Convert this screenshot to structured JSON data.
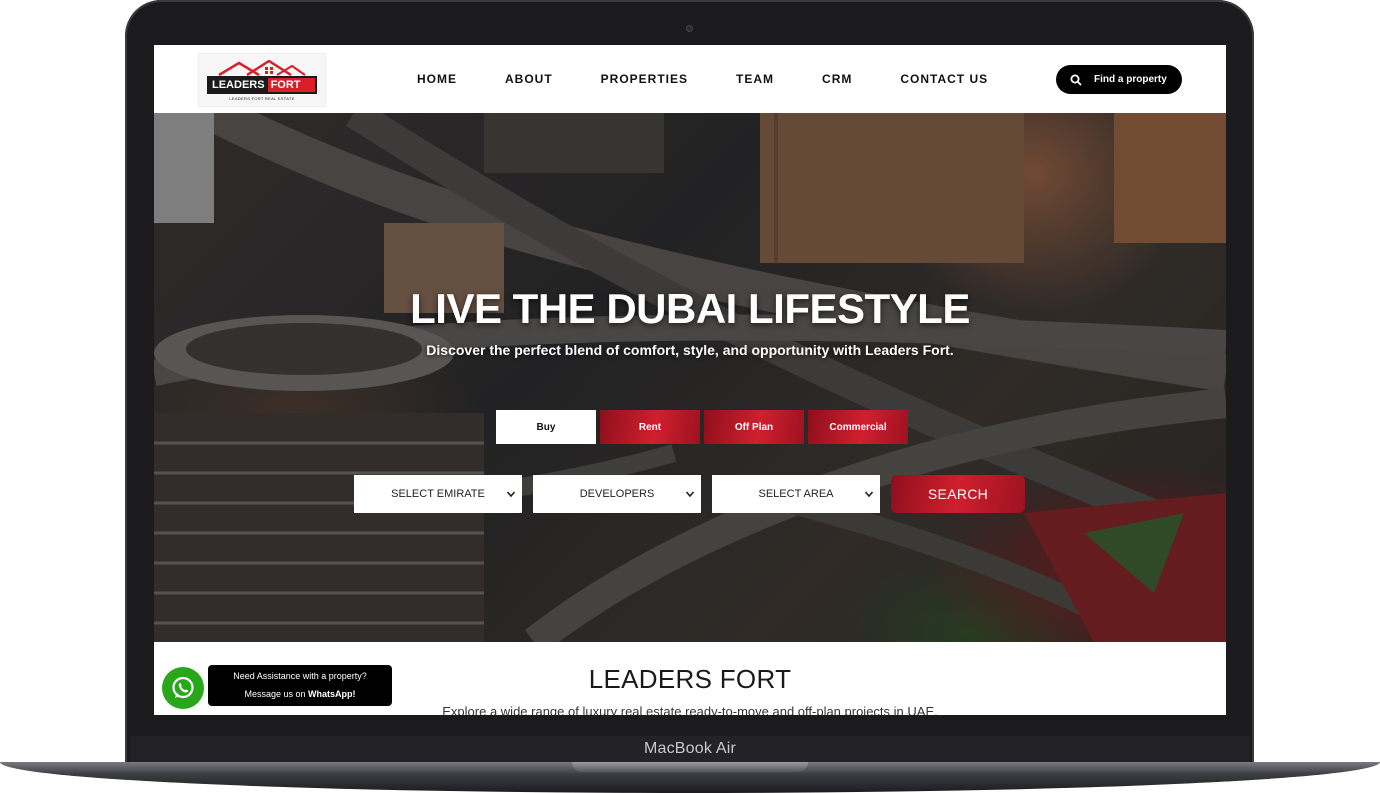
{
  "device": {
    "label": "MacBook Air"
  },
  "header": {
    "logo": {
      "word1": "LEADERS",
      "word2": "FORT",
      "tagline": "LEADERS FORT REAL ESTATE"
    },
    "nav": [
      "HOME",
      "ABOUT",
      "PROPERTIES",
      "TEAM",
      "CRM",
      "CONTACT US"
    ],
    "find_button": "Find a property"
  },
  "hero": {
    "title": "LIVE THE DUBAI LIFESTYLE",
    "subtitle": "Discover the perfect blend of comfort, style, and opportunity with Leaders Fort.",
    "tabs": [
      {
        "label": "Buy",
        "active": true
      },
      {
        "label": "Rent",
        "active": false
      },
      {
        "label": "Off Plan",
        "active": false
      },
      {
        "label": "Commercial",
        "active": false
      }
    ],
    "filters": {
      "emirate": "SELECT EMIRATE",
      "developers": "DEVELOPERS",
      "area": "SELECT AREA"
    },
    "search_label": "SEARCH"
  },
  "section": {
    "title": "LEADERS FORT",
    "text": "Explore a wide range of luxury real estate ready-to-move and off-plan projects in UAE."
  },
  "whatsapp": {
    "line1": "Need Assistance with a property?",
    "line2_prefix": "Message us on ",
    "line2_bold": "WhatsApp!"
  },
  "colors": {
    "accent": "#d01f2e",
    "whatsapp": "#29a71a"
  }
}
